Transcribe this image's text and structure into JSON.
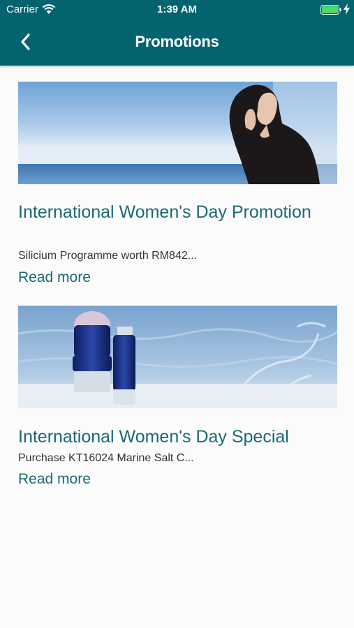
{
  "status_bar": {
    "carrier": "Carrier",
    "time": "1:39 AM"
  },
  "header": {
    "title": "Promotions",
    "back_icon": "chevron-left-icon"
  },
  "promotions": [
    {
      "title": "International Women's Day Promotion",
      "description": "Silicium Programme worth RM842...",
      "link": "Read more"
    },
    {
      "title": "International Women's Day Special",
      "description": "Purchase KT16024 Marine Salt C...",
      "link": "Read more"
    }
  ],
  "colors": {
    "header_bg": "#03636f",
    "accent_text": "#1b6877",
    "battery": "#4cd964"
  }
}
